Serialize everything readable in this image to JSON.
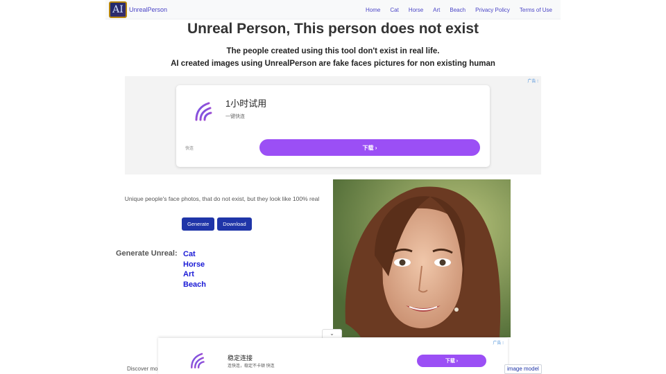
{
  "header": {
    "logo_text": "AI",
    "brand": "UnrealPerson",
    "nav": [
      "Home",
      "Cat",
      "Horse",
      "Art",
      "Beach",
      "Privacy Policy",
      "Terms of Use"
    ]
  },
  "main": {
    "title": "Unreal Person, This person does not exist",
    "subtitle_1": "The people created using this tool don't exist in real life.",
    "subtitle_2": "AI created images using UnrealPerson are fake faces pictures for non existing human",
    "unique_text": "Unique people's face photos, that do not exist, but they look like 100% real",
    "generate_button": "Generate",
    "download_button": "Download",
    "generate_label": "Generate Unreal:",
    "generate_links": [
      "Cat",
      "Horse",
      "Art",
      "Beach"
    ],
    "discover_text": "Discover mo",
    "image_model_text": "image model"
  },
  "ad_top": {
    "badge": "广告 ⁝",
    "title": "1小时试用",
    "subtitle": "一键快连",
    "small": "快连",
    "button": "下载 ›"
  },
  "ad_bottom": {
    "badge": "广告 ⁝",
    "title": "稳定连接",
    "subtitle": "连快连，稳定不卡顿 快连",
    "button": "下载 ›",
    "collapse_icon": "chevron-down-icon"
  },
  "colors": {
    "accent": "#4a44c6",
    "button_blue": "#1f35a8",
    "link_blue": "#1a1ad6",
    "ad_purple": "#9b4ff5"
  }
}
